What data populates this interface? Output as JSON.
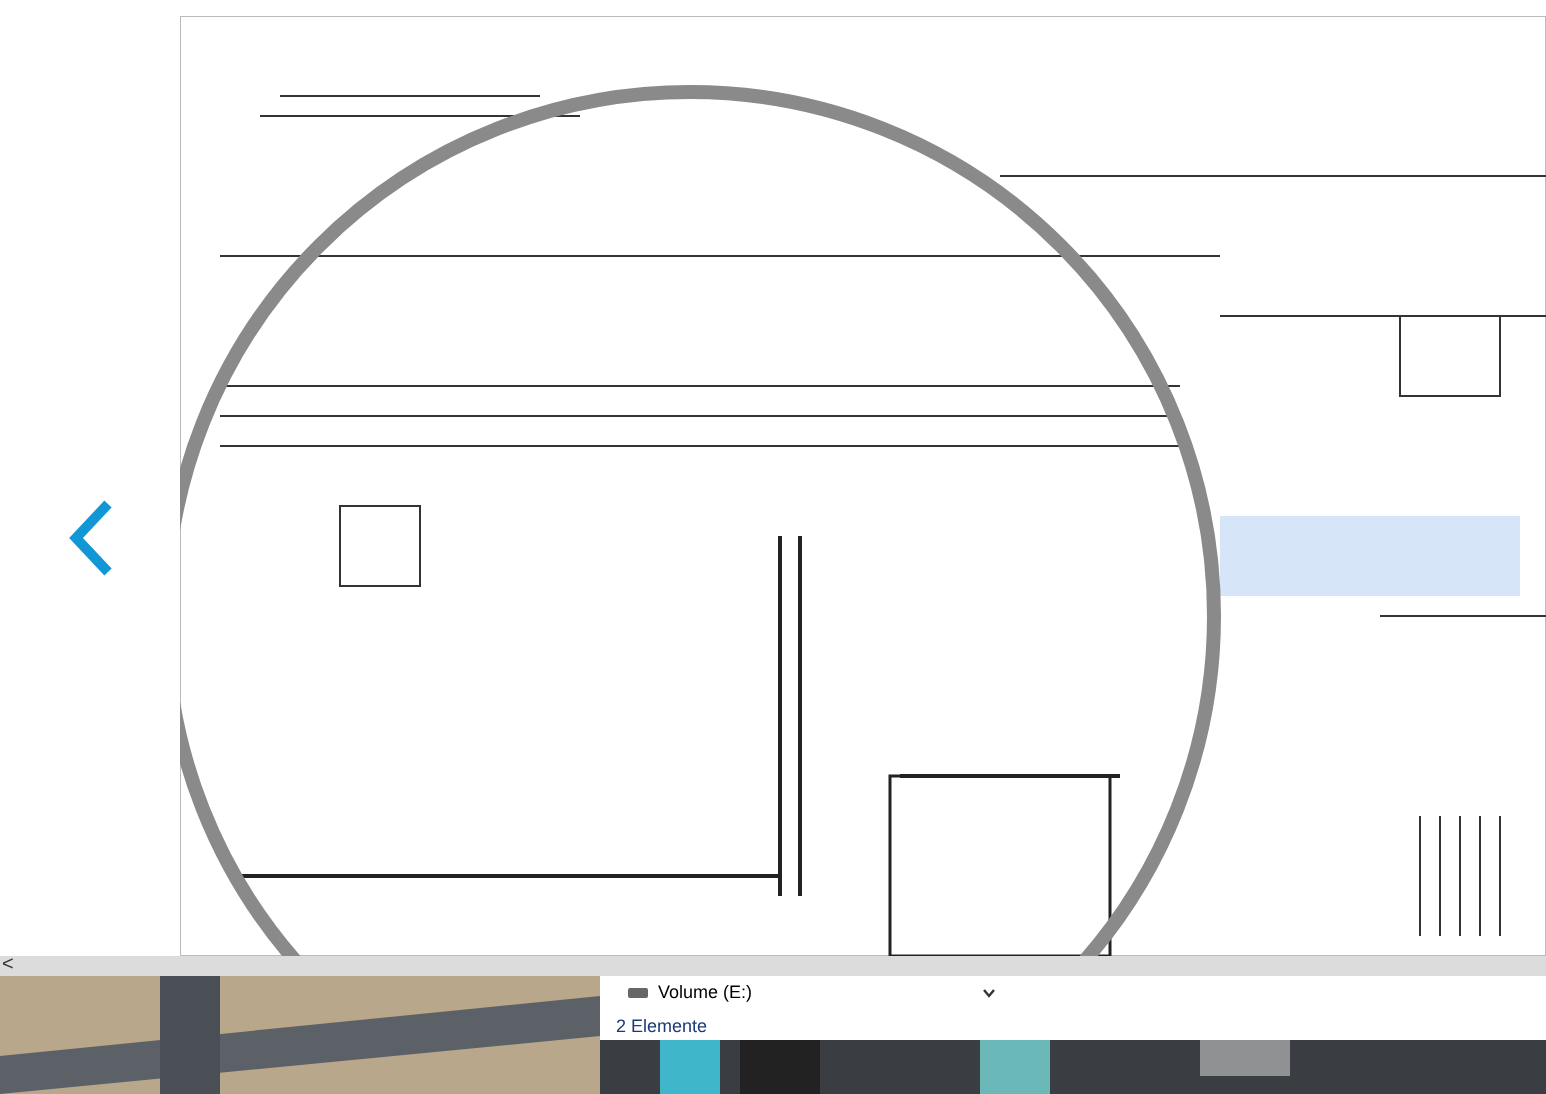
{
  "viewer": {
    "scroll_left": "<"
  },
  "explorer": {
    "drive": "Volume (E:)",
    "status": "2 Elemente"
  }
}
